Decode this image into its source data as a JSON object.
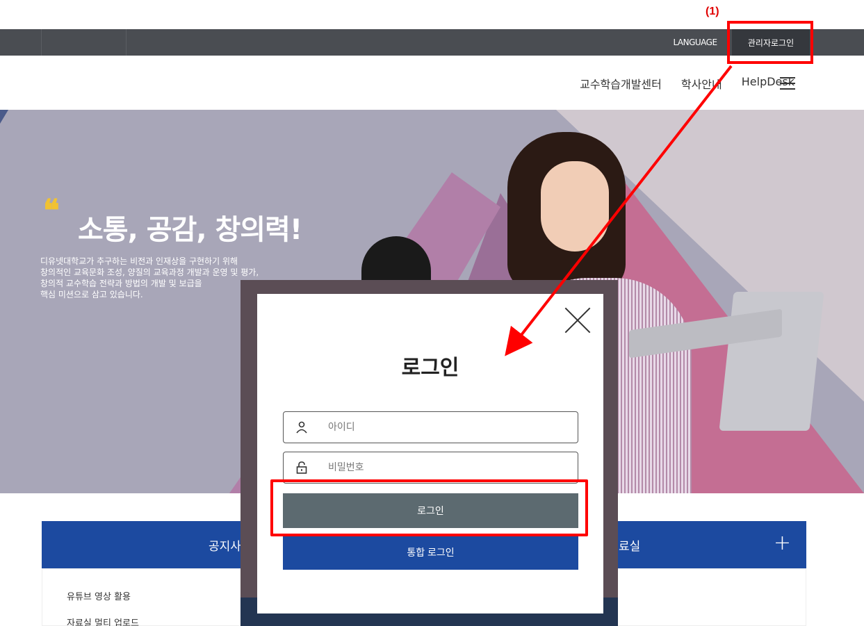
{
  "annotations": {
    "step_label": "(1)",
    "color": "#ff0000"
  },
  "topbar": {
    "language_label": "LANGUAGE",
    "admin_login_label": "관리자로그인"
  },
  "nav": {
    "items": [
      "교수학습개발센터",
      "학사안내",
      "HelpDesk"
    ],
    "menu_icon": "hamburger-icon"
  },
  "hero": {
    "quote_mark": "❝",
    "headline": "소통, 공감, 창의력!",
    "description": [
      "디유넷대학교가 추구하는 비전과 인재상을 구현하기 위해",
      "창의적인 교육문화 조성, 양질의 교육과정 개발과 운영 및 평가,",
      "창의적 교수학습 전략과 방법의 개발 및 보급을",
      "핵심 미션으로 삼고 있습니다."
    ]
  },
  "panels": {
    "notice_title": "공지사",
    "archive_title": "료실",
    "plus_glyph": "+",
    "list_items": [
      "유튜브 영상 활용",
      "자료실 멀티 업로드"
    ]
  },
  "login_modal": {
    "title": "로그인",
    "id_placeholder": "아이디",
    "password_placeholder": "비밀번호",
    "login_button": "로그인",
    "sso_button": "통합 로그인",
    "colors": {
      "login_button": "#5c6a70",
      "sso_button": "#1c4aa0"
    }
  }
}
